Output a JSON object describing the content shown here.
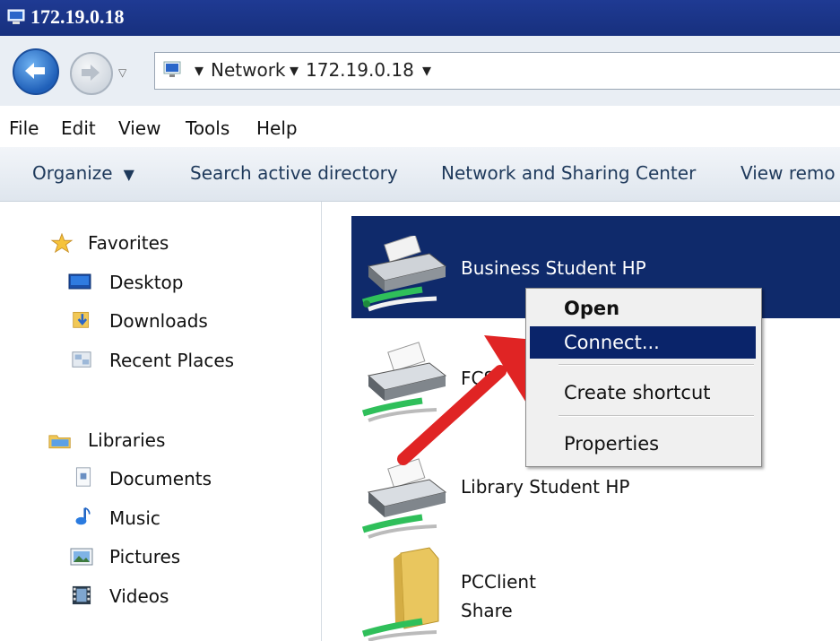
{
  "window": {
    "title": "172.19.0.18"
  },
  "address": {
    "crumbs": [
      "Network",
      "172.19.0.18"
    ]
  },
  "menu": {
    "items": [
      "File",
      "Edit",
      "View",
      "Tools",
      "Help"
    ]
  },
  "toolbar": {
    "organize": "Organize",
    "search_ad": "Search active directory",
    "network_sharing": "Network and Sharing Center",
    "view_remote": "View remo"
  },
  "sidebar": {
    "favorites": {
      "label": "Favorites",
      "items": [
        "Desktop",
        "Downloads",
        "Recent Places"
      ]
    },
    "libraries": {
      "label": "Libraries",
      "items": [
        "Documents",
        "Music",
        "Pictures",
        "Videos"
      ]
    }
  },
  "devices": [
    {
      "label": "Business Student HP",
      "type": "printer",
      "selected": true
    },
    {
      "label": "FCS",
      "type": "printer",
      "selected": false
    },
    {
      "label": "Library Student HP",
      "type": "printer",
      "selected": false
    },
    {
      "label_line1": "PCClient",
      "label_line2": "Share",
      "type": "share",
      "selected": false
    }
  ],
  "context_menu": {
    "items": [
      "Open",
      "Connect...",
      "Create shortcut",
      "Properties"
    ],
    "default": "Open",
    "highlighted": "Connect..."
  },
  "colors": {
    "selection": "#0f2a6b",
    "menu_highlight": "#0a246a",
    "arrow": "#e02424",
    "titlebar": "#1f3a93"
  }
}
